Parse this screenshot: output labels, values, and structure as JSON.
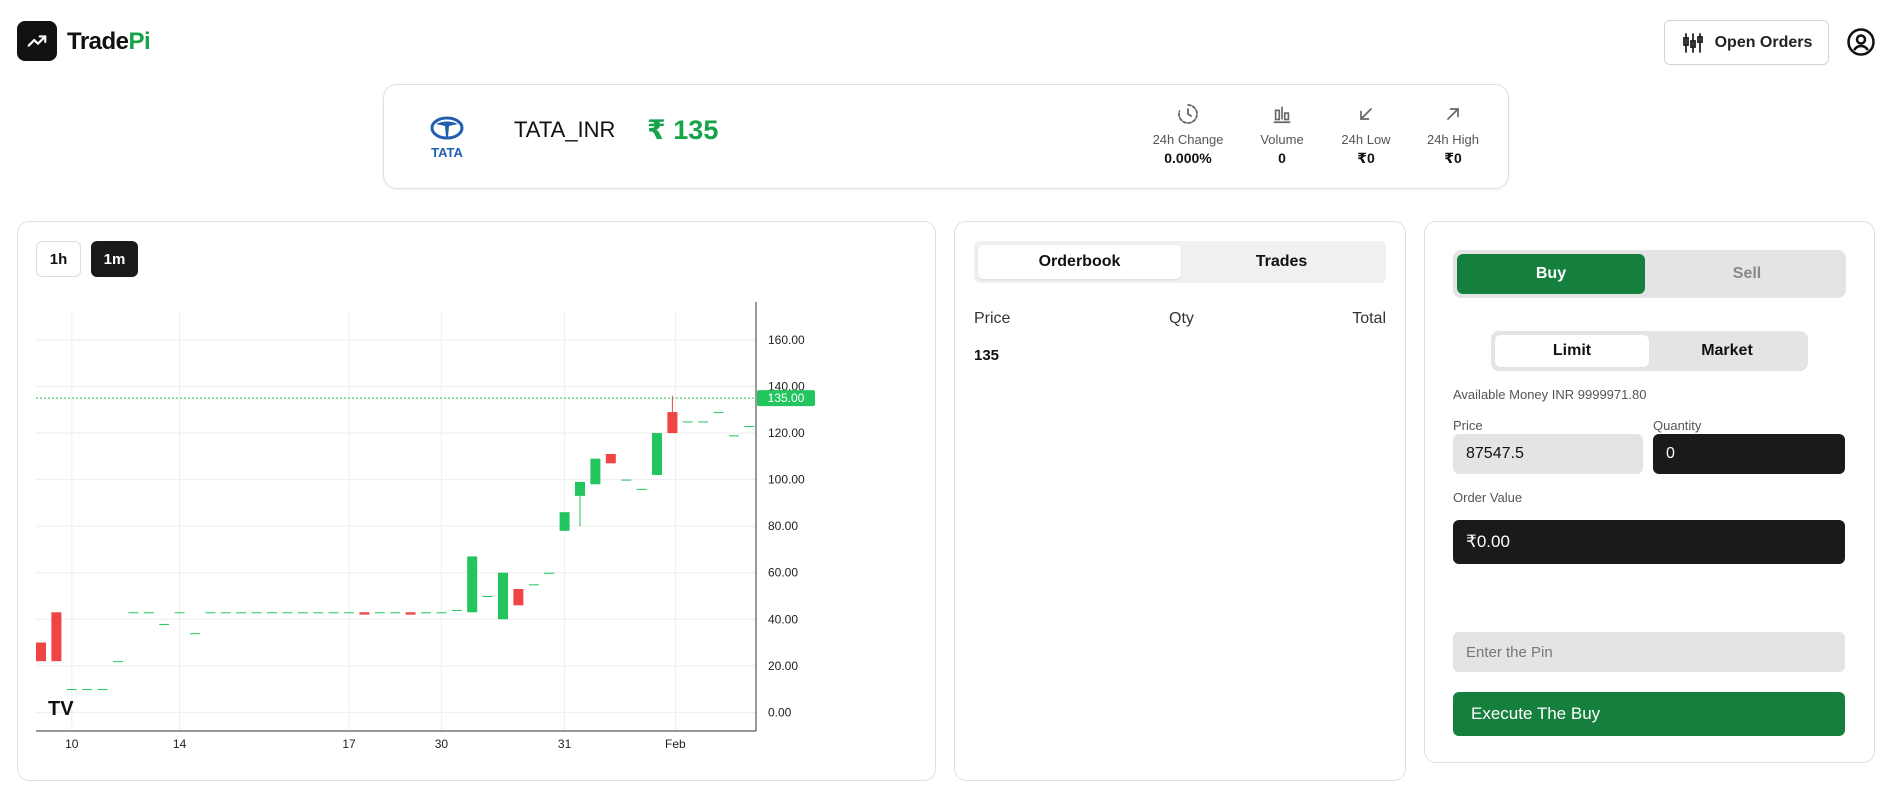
{
  "header": {
    "brand_main": "Trade",
    "brand_accent": "Pi",
    "open_orders_label": "Open Orders",
    "icons": [
      "trending-up-icon",
      "candlestick-icon",
      "user-circle-icon"
    ]
  },
  "ticker": {
    "logo_text": "TATA",
    "symbol": "TATA_INR",
    "price": "₹ 135",
    "stats": [
      {
        "label": "24h Change",
        "value": "0.000%",
        "icon": "clock-icon"
      },
      {
        "label": "Volume",
        "value": "0",
        "icon": "bar-chart-icon"
      },
      {
        "label": "24h Low",
        "value": "₹0",
        "icon": "arrow-down-left-icon"
      },
      {
        "label": "24h High",
        "value": "₹0",
        "icon": "arrow-up-right-icon"
      }
    ]
  },
  "chart": {
    "timeframes": [
      "1h",
      "1m"
    ],
    "active_timeframe": "1m",
    "last_price_label": "135.00",
    "watermark": "TV"
  },
  "chart_data": {
    "type": "candlestick",
    "y_ticks": [
      "0.00",
      "20.00",
      "40.00",
      "60.00",
      "80.00",
      "100.00",
      "120.00",
      "140.00",
      "160.00"
    ],
    "x_ticks": [
      "10",
      "14",
      "17",
      "30",
      "31",
      "Feb"
    ],
    "ylim": [
      -8,
      172
    ],
    "last_price": 135,
    "colors": {
      "up": "#22c55e",
      "down": "#ef4444",
      "last_line": "#22c55e"
    },
    "candles": [
      {
        "o": 30,
        "h": 30,
        "l": 22,
        "c": 22
      },
      {
        "o": 43,
        "h": 43,
        "l": 22,
        "c": 22
      },
      {
        "o": 10,
        "h": 10,
        "l": 10,
        "c": 10
      },
      {
        "o": 10,
        "h": 10,
        "l": 10,
        "c": 10
      },
      {
        "o": 10,
        "h": 10,
        "l": 10,
        "c": 10
      },
      {
        "o": 22,
        "h": 22,
        "l": 22,
        "c": 22
      },
      {
        "o": 43,
        "h": 43,
        "l": 43,
        "c": 43
      },
      {
        "o": 43,
        "h": 43,
        "l": 43,
        "c": 43
      },
      {
        "o": 38,
        "h": 38,
        "l": 38,
        "c": 38
      },
      {
        "o": 43,
        "h": 43,
        "l": 43,
        "c": 43
      },
      {
        "o": 34,
        "h": 34,
        "l": 34,
        "c": 34
      },
      {
        "o": 43,
        "h": 43,
        "l": 43,
        "c": 43
      },
      {
        "o": 43,
        "h": 43,
        "l": 43,
        "c": 43
      },
      {
        "o": 43,
        "h": 43,
        "l": 43,
        "c": 43
      },
      {
        "o": 43,
        "h": 43,
        "l": 43,
        "c": 43
      },
      {
        "o": 43,
        "h": 43,
        "l": 43,
        "c": 43
      },
      {
        "o": 43,
        "h": 43,
        "l": 43,
        "c": 43
      },
      {
        "o": 43,
        "h": 43,
        "l": 43,
        "c": 43
      },
      {
        "o": 43,
        "h": 43,
        "l": 43,
        "c": 43
      },
      {
        "o": 43,
        "h": 43,
        "l": 43,
        "c": 43
      },
      {
        "o": 43,
        "h": 43,
        "l": 43,
        "c": 43
      },
      {
        "o": 43,
        "h": 43,
        "l": 43,
        "c": 42
      },
      {
        "o": 43,
        "h": 43,
        "l": 43,
        "c": 43
      },
      {
        "o": 43,
        "h": 43,
        "l": 43,
        "c": 43
      },
      {
        "o": 43,
        "h": 43,
        "l": 43,
        "c": 42
      },
      {
        "o": 43,
        "h": 43,
        "l": 43,
        "c": 43
      },
      {
        "o": 43,
        "h": 43,
        "l": 43,
        "c": 43
      },
      {
        "o": 44,
        "h": 44,
        "l": 44,
        "c": 44
      },
      {
        "o": 43,
        "h": 67,
        "l": 43,
        "c": 67
      },
      {
        "o": 50,
        "h": 50,
        "l": 50,
        "c": 50
      },
      {
        "o": 40,
        "h": 60,
        "l": 40,
        "c": 60
      },
      {
        "o": 53,
        "h": 53,
        "l": 46,
        "c": 46
      },
      {
        "o": 55,
        "h": 55,
        "l": 55,
        "c": 55
      },
      {
        "o": 60,
        "h": 60,
        "l": 60,
        "c": 60
      },
      {
        "o": 78,
        "h": 86,
        "l": 78,
        "c": 86
      },
      {
        "o": 93,
        "h": 99,
        "l": 80,
        "c": 99
      },
      {
        "o": 98,
        "h": 109,
        "l": 98,
        "c": 109
      },
      {
        "o": 111,
        "h": 111,
        "l": 107,
        "c": 107
      },
      {
        "o": 100,
        "h": 100,
        "l": 100,
        "c": 100
      },
      {
        "o": 96,
        "h": 96,
        "l": 96,
        "c": 96
      },
      {
        "o": 102,
        "h": 120,
        "l": 102,
        "c": 120
      },
      {
        "o": 129,
        "h": 136,
        "l": 120,
        "c": 120
      },
      {
        "o": 125,
        "h": 125,
        "l": 125,
        "c": 125
      },
      {
        "o": 125,
        "h": 125,
        "l": 125,
        "c": 125
      },
      {
        "o": 129,
        "h": 129,
        "l": 129,
        "c": 129
      },
      {
        "o": 119,
        "h": 119,
        "l": 119,
        "c": 119
      },
      {
        "o": 123,
        "h": 123,
        "l": 123,
        "c": 123
      }
    ]
  },
  "orderbook": {
    "tabs": [
      "Orderbook",
      "Trades"
    ],
    "active_tab": "Orderbook",
    "headers": {
      "price": "Price",
      "qty": "Qty",
      "total": "Total"
    },
    "rows": [
      {
        "price": "135",
        "qty": "",
        "total": ""
      }
    ]
  },
  "trade": {
    "sides": [
      "Buy",
      "Sell"
    ],
    "active_side": "Buy",
    "types": [
      "Limit",
      "Market"
    ],
    "active_type": "Limit",
    "available": "Available Money INR 9999971.80",
    "price_label": "Price",
    "price_value": "87547.5",
    "quantity_label": "Quantity",
    "quantity_value": "0",
    "order_value_label": "Order Value",
    "order_value": "₹0.00",
    "pin_placeholder": "Enter the Pin",
    "execute_label": "Execute The Buy",
    "colors": {
      "buy": "#15803d",
      "dark": "#1a1a1a"
    }
  }
}
